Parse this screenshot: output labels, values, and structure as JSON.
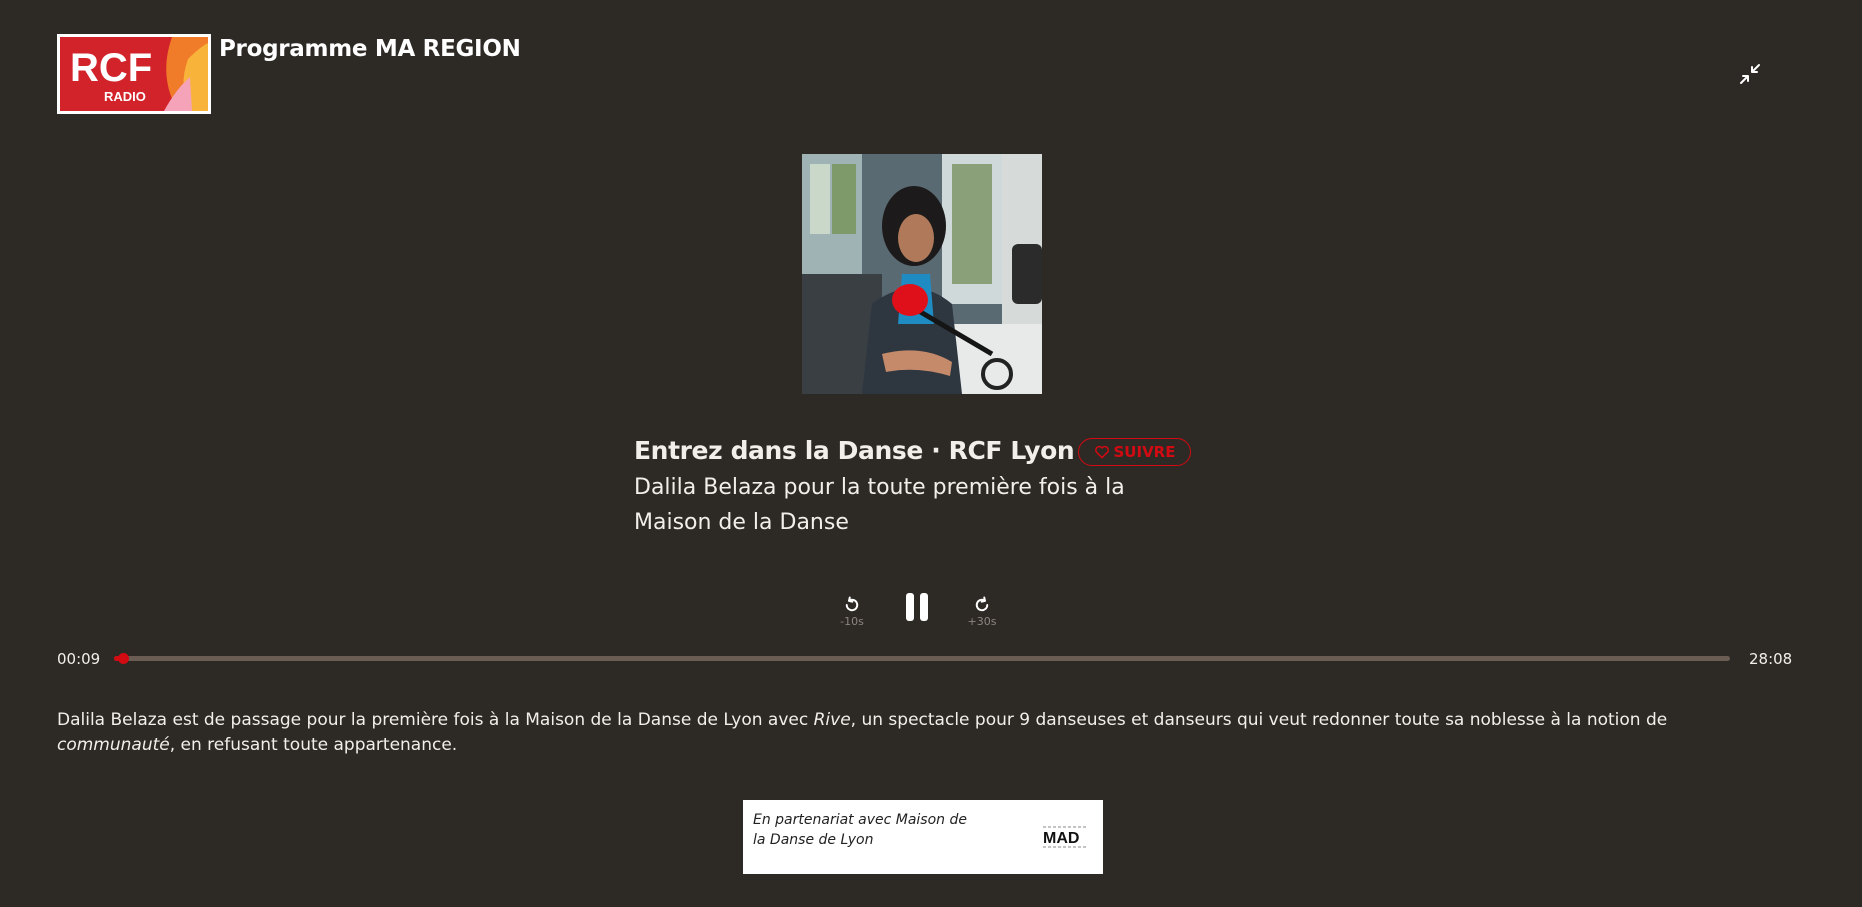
{
  "header": {
    "logo_text": "RCF",
    "logo_subtext": "RADIO",
    "program_title": "Programme MA REGION"
  },
  "episode": {
    "show_title": "Entrez dans la Danse · RCF Lyon",
    "follow_label": "SUIVRE",
    "title": "Dalila Belaza pour la toute première fois à la Maison de la Danse"
  },
  "player": {
    "rewind_label": "-10s",
    "forward_label": "+30s",
    "current_time": "00:09",
    "total_time": "28:08",
    "progress_fraction": 0.0053
  },
  "description": {
    "part1": "Dalila Belaza est de passage pour la première fois à la Maison de la Danse de Lyon avec ",
    "italic1": "Rive",
    "part2": ", un spectacle pour 9 danseuses et danseurs qui veut redonner toute sa noblesse à la notion de ",
    "italic2": "communauté",
    "part3": ", en refusant toute appartenance."
  },
  "partner": {
    "text": "En partenariat avec Maison de la Danse de Lyon",
    "logo_text": "MAD"
  },
  "colors": {
    "background": "#2d2925",
    "accent": "#d20a12",
    "track": "#6b5d54"
  },
  "icons": {
    "collapse": "collapse-arrows-icon",
    "heart": "heart-outline-icon",
    "rewind": "rotate-left-icon",
    "forward": "rotate-right-icon",
    "pause": "pause-icon"
  }
}
